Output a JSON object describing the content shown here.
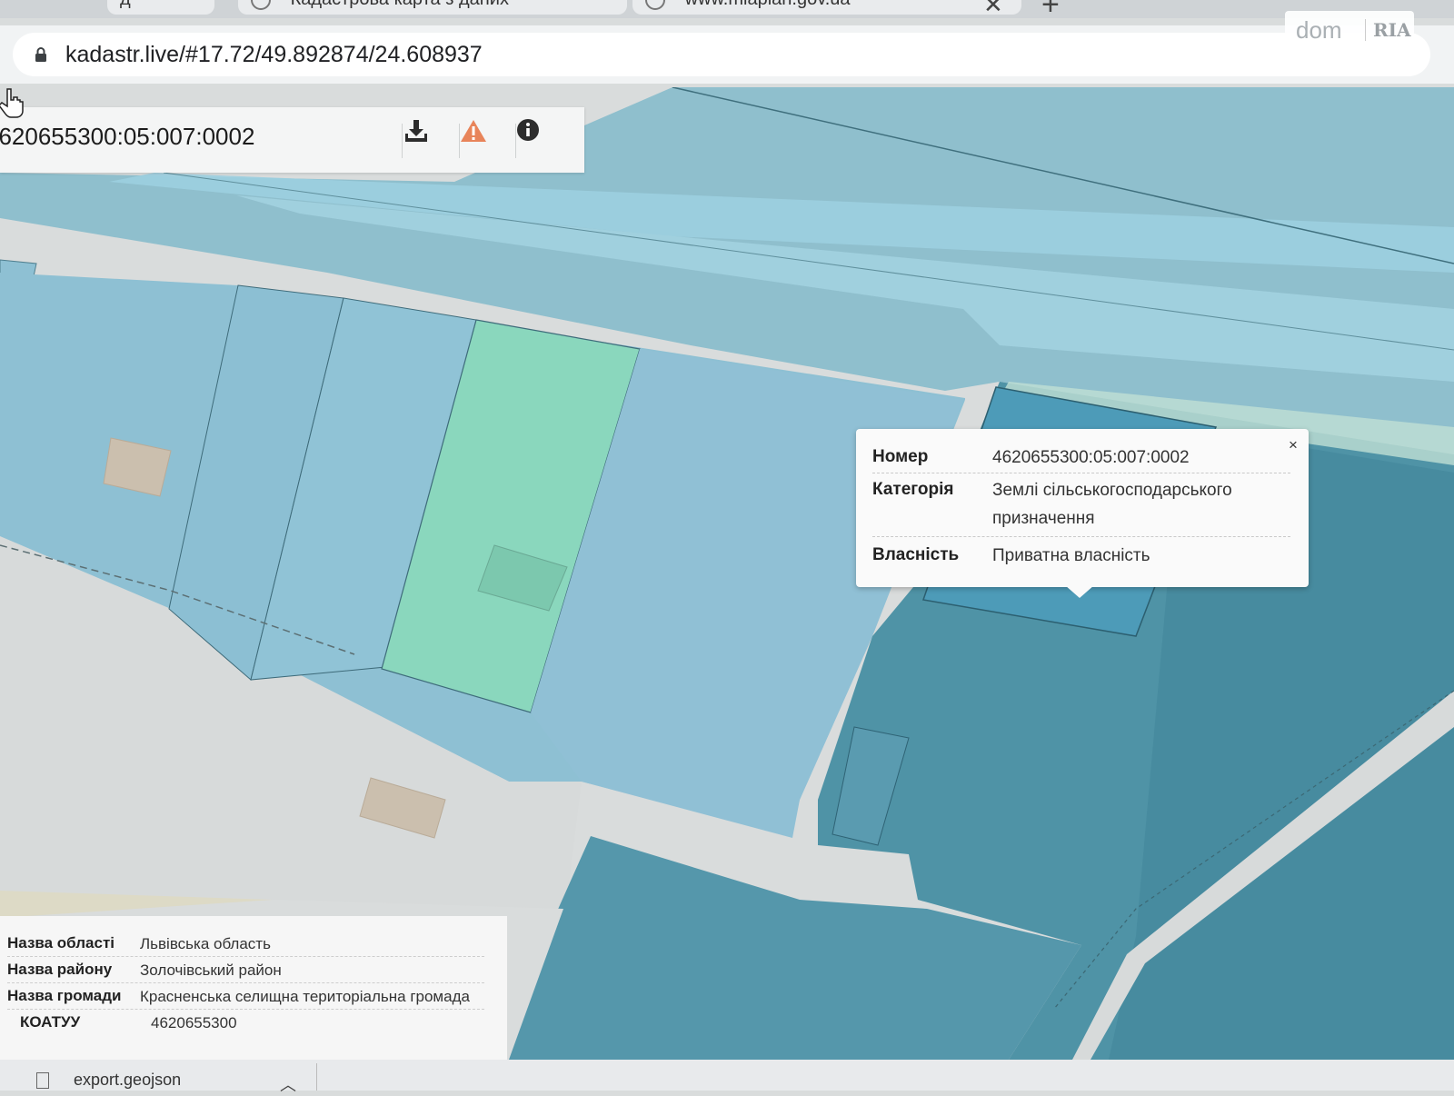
{
  "browser": {
    "tabs": [
      {
        "label": "д"
      },
      {
        "label": "Кадастрова карта з даних"
      },
      {
        "label": "www.mlaplan.gov.ua"
      }
    ],
    "url": "kadastr.live/#17.72/49.892874/24.608937"
  },
  "watermark": {
    "part1": "dom",
    "part2": "RIA"
  },
  "search": {
    "value": "4620655300:05:007:0002"
  },
  "toolbar": {
    "buttons": [
      "download-icon",
      "warning-icon",
      "info-icon"
    ],
    "colors": {
      "warning": "#e8845a",
      "icons": "#2d2d2d"
    }
  },
  "popup": {
    "close_label": "×",
    "rows": [
      {
        "key": "Номер",
        "value": "4620655300:05:007:0002"
      },
      {
        "key": "Категорія",
        "value": "Землі сільськогосподарського призначення"
      },
      {
        "key": "Власність",
        "value": "Приватна власність"
      }
    ]
  },
  "info_panel": {
    "rows": [
      {
        "key": "Назва області",
        "value": "Львівська область"
      },
      {
        "key": "Назва району",
        "value": "Золочівський район"
      },
      {
        "key": "Назва громади",
        "value": "Красненська селищна територіальна громада"
      },
      {
        "key": "КОАТУУ",
        "value": "4620655300"
      }
    ]
  },
  "download_shelf": {
    "file_name": "export.geojson"
  },
  "map_colors": {
    "background": "#d9dcdc",
    "parcel_blue": "#8ec0d3",
    "parcel_light_blue": "#a3d0dc",
    "parcel_green": "#8ad7bd",
    "parcel_selected": "#4d9bb8",
    "parcel_dark": "#4b8f9f",
    "building": "#cbbfae"
  }
}
